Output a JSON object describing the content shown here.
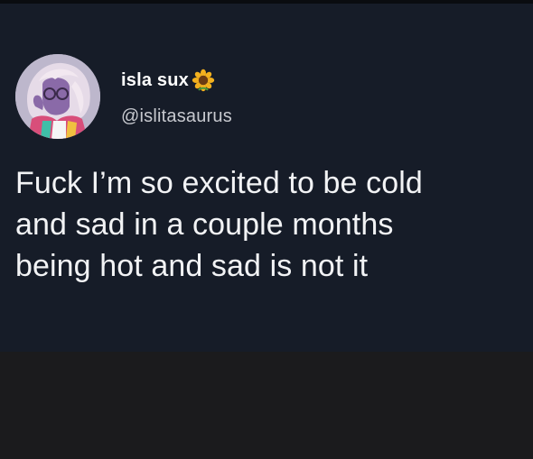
{
  "tweet": {
    "author": {
      "display_name": "isla sux",
      "name_emoji": "sunflower-icon",
      "handle": "@islitasaurus",
      "avatar": "avatar-illustration"
    },
    "text_lines": [
      "Fuck I’m so excited to be cold",
      "and sad in a couple months",
      "being hot and sad is not it"
    ]
  },
  "colors": {
    "card_background": "#161c28",
    "page_background": "#1b1b1d",
    "text_primary": "#f2f3f5",
    "text_secondary": "#c7c9cf"
  }
}
